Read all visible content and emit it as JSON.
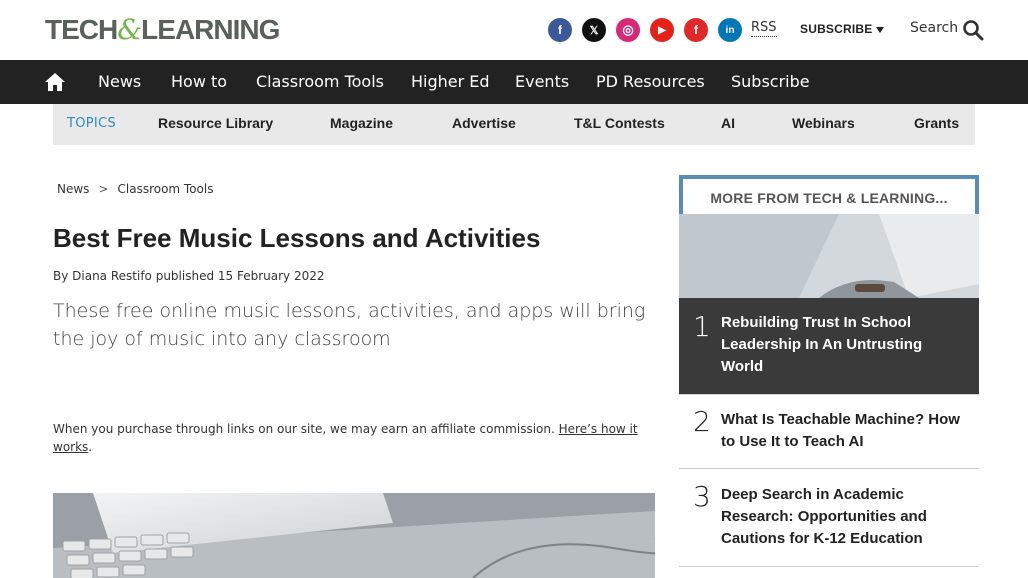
{
  "header": {
    "logo_text_left": "TECH",
    "logo_amp": "&",
    "logo_text_right": "LEARNING",
    "social": [
      {
        "icon": "facebook-icon",
        "glyph": "f",
        "color": "#3b5998"
      },
      {
        "icon": "x-icon",
        "glyph": "𝕏",
        "color": "#111111"
      },
      {
        "icon": "instagram-icon",
        "glyph": "◎",
        "color": "#d62976"
      },
      {
        "icon": "youtube-icon",
        "glyph": "▶",
        "color": "#e62117"
      },
      {
        "icon": "flipboard-icon",
        "glyph": "f",
        "color": "#e12828"
      },
      {
        "icon": "linkedin-icon",
        "glyph": "in",
        "color": "#0077b5"
      }
    ],
    "rss_label": "RSS",
    "subscribe_label": "SUBSCRIBE",
    "search_label": "Search"
  },
  "mainnav": {
    "items": [
      "News",
      "How to",
      "Classroom Tools",
      "Higher Ed",
      "Events",
      "PD Resources",
      "Subscribe"
    ]
  },
  "topics": {
    "label": "TOPICS",
    "items": [
      "Resource Library",
      "Magazine",
      "Advertise",
      "T&L Contests",
      "AI",
      "Webinars",
      "Grants"
    ]
  },
  "article": {
    "breadcrumb": [
      "News",
      "Classroom Tools"
    ],
    "breadcrumb_sep": ">",
    "title": "Best Free Music Lessons and Activities",
    "byline": "By Diana Restifo published 15 February 2022",
    "strap": "These free online music lessons, activities, and apps will bring the joy of music into any classroom",
    "affiliate_text": "When you purchase through links on our site, we may earn an affiliate commission. ",
    "affiliate_link": "Here’s how it works",
    "affiliate_end": "."
  },
  "sidebar": {
    "title": "MORE FROM TECH & LEARNING...",
    "items": [
      {
        "rank": "1",
        "title": "Rebuilding Trust In School Leadership In An Untrusting World"
      },
      {
        "rank": "2",
        "title": "What Is Teachable Machine? How to Use It to Teach AI"
      },
      {
        "rank": "3",
        "title": "Deep Search in Academic Research: Opportunities and Cautions for K-12 Education"
      }
    ]
  },
  "colors": {
    "nav_bg": "#222222",
    "topics_bg": "#e9e9e9",
    "accent_blue": "#2d8bbf",
    "sidebar_border": "#5a8db5",
    "logo_green": "#74b54a",
    "logo_gray": "#59615a"
  }
}
